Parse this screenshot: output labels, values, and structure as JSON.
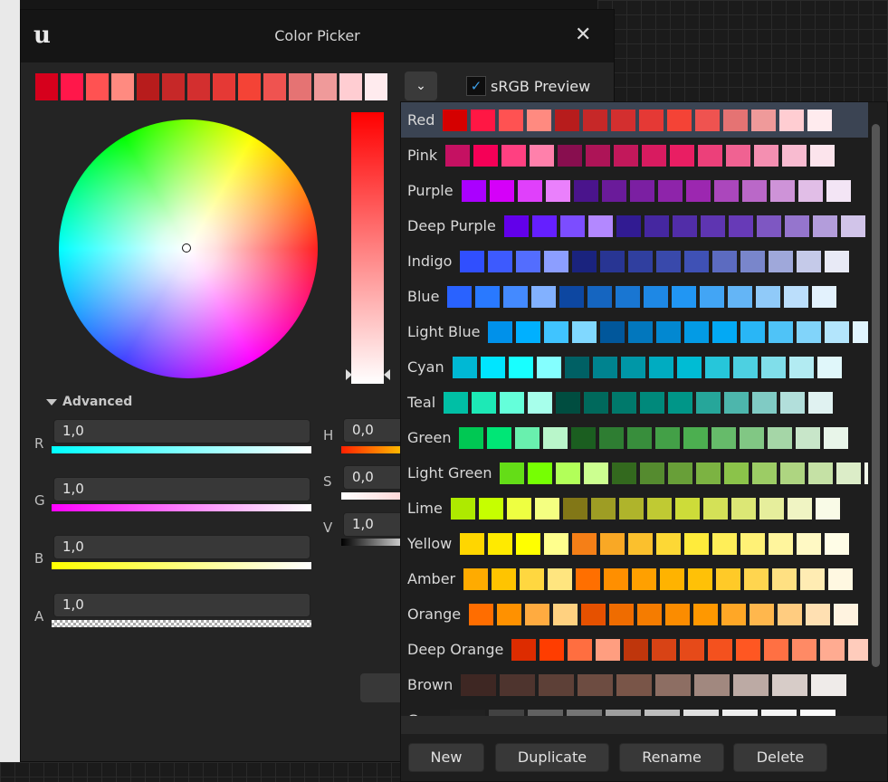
{
  "window": {
    "title": "Color Picker",
    "logo_icon": "unreal-logo-icon",
    "close_icon": "close-icon"
  },
  "recent_colors": [
    "#d6001c",
    "#ff174a",
    "#ff5252",
    "#ff8a80",
    "#b71c1c",
    "#c62828",
    "#d32f2f",
    "#e53935",
    "#f44336",
    "#ef5350",
    "#e57373",
    "#ef9a9a",
    "#ffcdd2",
    "#ffebee"
  ],
  "srgb_preview": {
    "label": "sRGB Preview",
    "checked": true
  },
  "advanced_label": "Advanced",
  "channels": {
    "r": {
      "label": "R",
      "value": "1,0"
    },
    "g": {
      "label": "G",
      "value": "1,0"
    },
    "b": {
      "label": "B",
      "value": "1,0"
    },
    "a": {
      "label": "A",
      "value": "1,0"
    },
    "h": {
      "label": "H",
      "value": "0,0"
    },
    "s": {
      "label": "S",
      "value": "0,0"
    },
    "v": {
      "label": "V",
      "value": "1,0"
    }
  },
  "palette_buttons": {
    "new": "New",
    "duplicate": "Duplicate",
    "rename": "Rename",
    "delete": "Delete"
  },
  "palettes": [
    {
      "name": "Red",
      "selected": true,
      "colors": [
        "#d50000",
        "#ff1744",
        "#ff5252",
        "#ff8a80",
        "#b71c1c",
        "#c62828",
        "#d32f2f",
        "#e53935",
        "#f44336",
        "#ef5350",
        "#e57373",
        "#ef9a9a",
        "#ffcdd2",
        "#ffebee"
      ]
    },
    {
      "name": "Pink",
      "colors": [
        "#c51162",
        "#f50057",
        "#ff4081",
        "#ff80ab",
        "#880e4f",
        "#ad1457",
        "#c2185b",
        "#d81b60",
        "#e91e63",
        "#ec407a",
        "#f06292",
        "#f48fb1",
        "#f8bbd0",
        "#fce4ec"
      ]
    },
    {
      "name": "Purple",
      "colors": [
        "#aa00ff",
        "#d500f9",
        "#e040fb",
        "#ea80fc",
        "#4a148c",
        "#6a1b9a",
        "#7b1fa2",
        "#8e24aa",
        "#9c27b0",
        "#ab47bc",
        "#ba68c8",
        "#ce93d8",
        "#e1bee7",
        "#f3e5f5"
      ]
    },
    {
      "name": "Deep Purple",
      "colors": [
        "#6200ea",
        "#651fff",
        "#7c4dff",
        "#b388ff",
        "#311b92",
        "#4527a0",
        "#512da8",
        "#5e35b1",
        "#673ab7",
        "#7e57c2",
        "#9575cd",
        "#b39ddb",
        "#d1c4e9",
        "#ede7f6"
      ]
    },
    {
      "name": "Indigo",
      "colors": [
        "#304ffe",
        "#3d5afe",
        "#536dfe",
        "#8c9eff",
        "#1a237e",
        "#283593",
        "#303f9f",
        "#3949ab",
        "#3f51b5",
        "#5c6bc0",
        "#7986cb",
        "#9fa8da",
        "#c5cae9",
        "#e8eaf6"
      ]
    },
    {
      "name": "Blue",
      "colors": [
        "#2962ff",
        "#2979ff",
        "#448aff",
        "#82b1ff",
        "#0d47a1",
        "#1565c0",
        "#1976d2",
        "#1e88e5",
        "#2196f3",
        "#42a5f5",
        "#64b5f6",
        "#90caf9",
        "#bbdefb",
        "#e3f2fd"
      ]
    },
    {
      "name": "Light Blue",
      "colors": [
        "#0091ea",
        "#00b0ff",
        "#40c4ff",
        "#80d8ff",
        "#01579b",
        "#0277bd",
        "#0288d1",
        "#039be5",
        "#03a9f4",
        "#29b6f6",
        "#4fc3f7",
        "#81d4fa",
        "#b3e5fc",
        "#e1f5fe"
      ]
    },
    {
      "name": "Cyan",
      "colors": [
        "#00b8d4",
        "#00e5ff",
        "#18ffff",
        "#84ffff",
        "#006064",
        "#00838f",
        "#0097a7",
        "#00acc1",
        "#00bcd4",
        "#26c6da",
        "#4dd0e1",
        "#80deea",
        "#b2ebf2",
        "#e0f7fa"
      ]
    },
    {
      "name": "Teal",
      "colors": [
        "#00bfa5",
        "#1de9b6",
        "#64ffda",
        "#a7ffeb",
        "#004d40",
        "#00695c",
        "#00796b",
        "#00897b",
        "#009688",
        "#26a69a",
        "#4db6ac",
        "#80cbc4",
        "#b2dfdb",
        "#e0f2f1"
      ]
    },
    {
      "name": "Green",
      "colors": [
        "#00c853",
        "#00e676",
        "#69f0ae",
        "#b9f6ca",
        "#1b5e20",
        "#2e7d32",
        "#388e3c",
        "#43a047",
        "#4caf50",
        "#66bb6a",
        "#81c784",
        "#a5d6a7",
        "#c8e6c9",
        "#e8f5e9"
      ]
    },
    {
      "name": "Light Green",
      "colors": [
        "#64dd17",
        "#76ff03",
        "#b2ff59",
        "#ccff90",
        "#33691e",
        "#558b2f",
        "#689f38",
        "#7cb342",
        "#8bc34a",
        "#9ccc65",
        "#aed581",
        "#c5e1a5",
        "#dcedc8",
        "#f1f8e9"
      ]
    },
    {
      "name": "Lime",
      "colors": [
        "#aeea00",
        "#c6ff00",
        "#eeff41",
        "#f4ff81",
        "#827717",
        "#9e9d24",
        "#afb42b",
        "#c0ca33",
        "#cddc39",
        "#d4e157",
        "#dce775",
        "#e6ee9c",
        "#f0f4c3",
        "#f9fbe7"
      ]
    },
    {
      "name": "Yellow",
      "colors": [
        "#ffd600",
        "#ffea00",
        "#ffff00",
        "#ffff8d",
        "#f57f17",
        "#f9a825",
        "#fbc02d",
        "#fdd835",
        "#ffeb3b",
        "#ffee58",
        "#fff176",
        "#fff59d",
        "#fff9c4",
        "#fffde7"
      ]
    },
    {
      "name": "Amber",
      "colors": [
        "#ffab00",
        "#ffc400",
        "#ffd740",
        "#ffe57f",
        "#ff6f00",
        "#ff8f00",
        "#ffa000",
        "#ffb300",
        "#ffc107",
        "#ffca28",
        "#ffd54f",
        "#ffe082",
        "#ffecb3",
        "#fff8e1"
      ]
    },
    {
      "name": "Orange",
      "colors": [
        "#ff6d00",
        "#ff9100",
        "#ffab40",
        "#ffd180",
        "#e65100",
        "#ef6c00",
        "#f57c00",
        "#fb8c00",
        "#ff9800",
        "#ffa726",
        "#ffb74d",
        "#ffcc80",
        "#ffe0b2",
        "#fff3e0"
      ]
    },
    {
      "name": "Deep Orange",
      "colors": [
        "#dd2c00",
        "#ff3d00",
        "#ff6e40",
        "#ff9e80",
        "#bf360c",
        "#d84315",
        "#e64a19",
        "#f4511e",
        "#ff5722",
        "#ff7043",
        "#ff8a65",
        "#ffab91",
        "#ffccbc",
        "#fbe9e7"
      ]
    },
    {
      "name": "Brown",
      "colors": [
        "#3e2723",
        "#4e342e",
        "#5d4037",
        "#6d4c41",
        "#795548",
        "#8d6e63",
        "#a1887f",
        "#bcaaa4",
        "#d7ccc8",
        "#efebe9"
      ]
    },
    {
      "name": "Grey",
      "colors": [
        "#212121",
        "#424242",
        "#616161",
        "#757575",
        "#9e9e9e",
        "#bdbdbd",
        "#e0e0e0",
        "#eeeeee",
        "#f5f5f5",
        "#fafafa"
      ]
    }
  ]
}
